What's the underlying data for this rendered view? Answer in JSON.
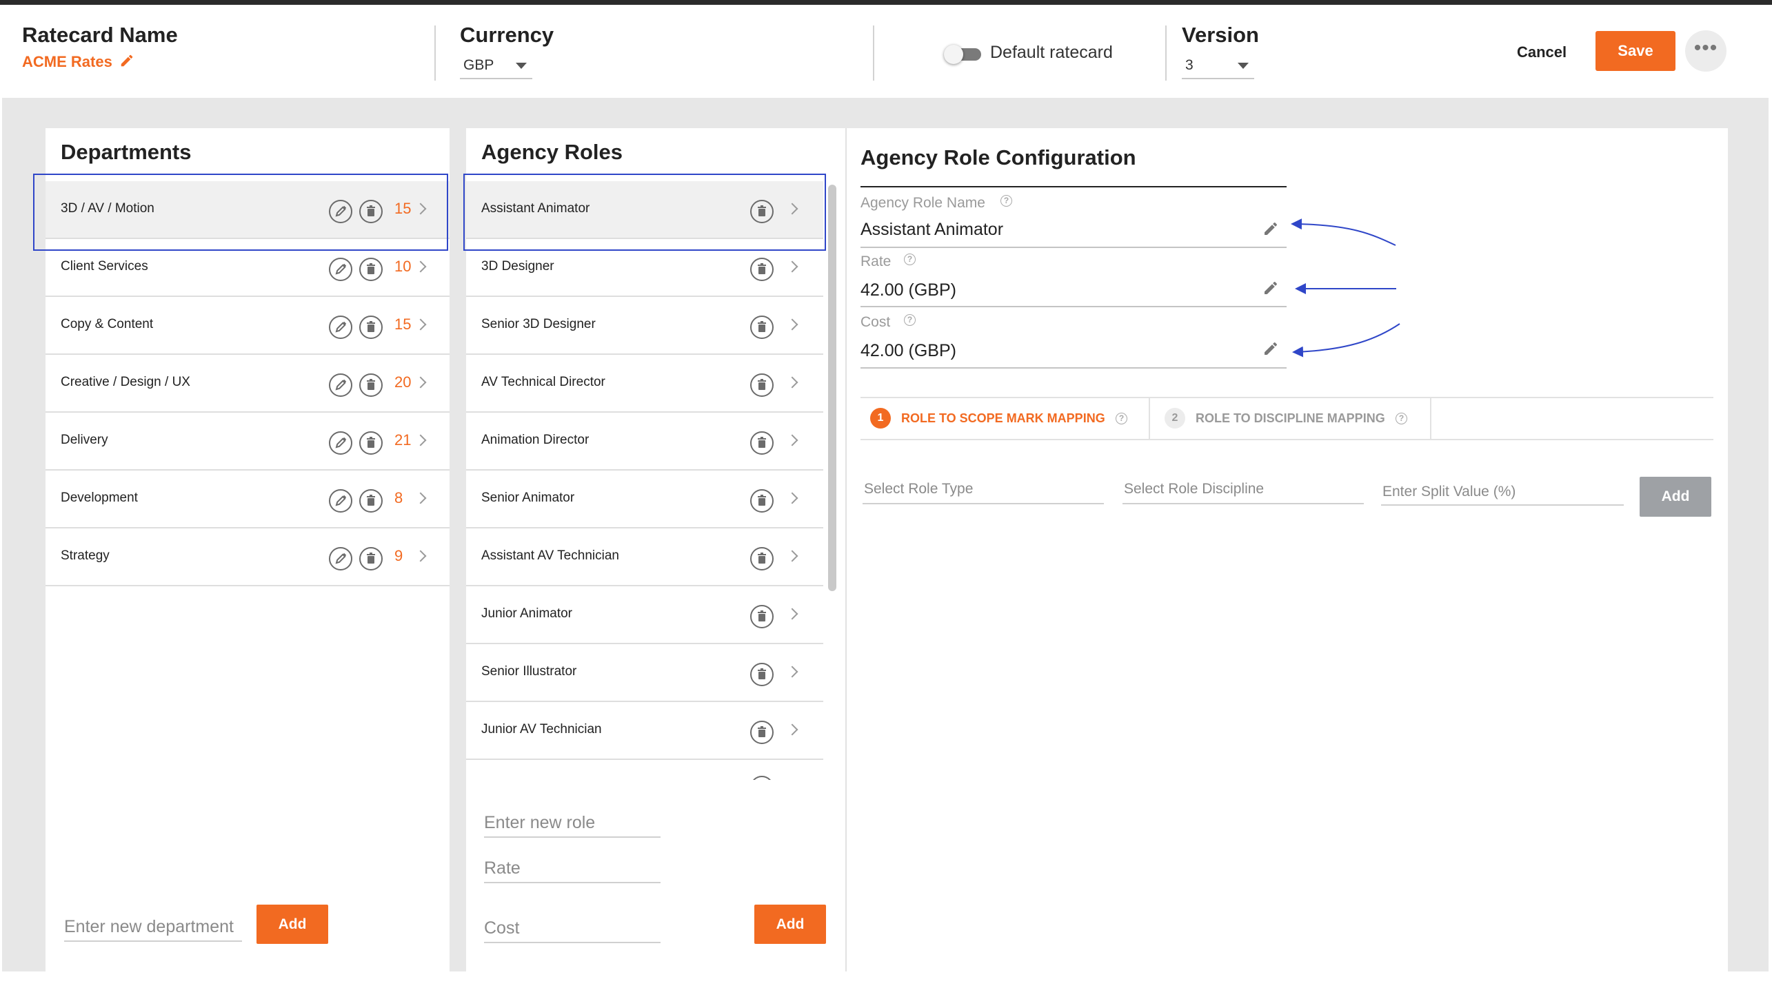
{
  "header": {
    "ratecard_title": "Ratecard Name",
    "ratecard_name": "ACME Rates",
    "currency_title": "Currency",
    "currency_value": "GBP",
    "default_label": "Default ratecard",
    "version_title": "Version",
    "version_value": "3",
    "cancel_label": "Cancel",
    "save_label": "Save",
    "more_label": "•••"
  },
  "departments": {
    "title": "Departments",
    "items": [
      {
        "label": "3D / AV / Motion",
        "count": "15"
      },
      {
        "label": "Client Services",
        "count": "10"
      },
      {
        "label": "Copy & Content",
        "count": "15"
      },
      {
        "label": "Creative / Design / UX",
        "count": "20"
      },
      {
        "label": "Delivery",
        "count": "21"
      },
      {
        "label": "Development",
        "count": "8"
      },
      {
        "label": "Strategy",
        "count": "9"
      }
    ],
    "new_placeholder": "Enter new department",
    "add_label": "Add"
  },
  "roles": {
    "title": "Agency Roles",
    "items": [
      {
        "label": "Assistant Animator"
      },
      {
        "label": "3D Designer"
      },
      {
        "label": "Senior 3D Designer"
      },
      {
        "label": "AV Technical Director"
      },
      {
        "label": "Animation Director"
      },
      {
        "label": "Senior Animator"
      },
      {
        "label": "Assistant AV Technician"
      },
      {
        "label": "Junior Animator"
      },
      {
        "label": "Senior Illustrator"
      },
      {
        "label": "Junior AV Technician"
      }
    ],
    "role_placeholder": "Enter new role",
    "rate_placeholder": "Rate",
    "cost_placeholder": "Cost",
    "add_label": "Add"
  },
  "config": {
    "title": "Agency Role Configuration",
    "name_label": "Agency Role Name",
    "name_value": "Assistant Animator",
    "rate_label": "Rate",
    "rate_value": "42.00 (GBP)",
    "cost_label": "Cost",
    "cost_value": "42.00 (GBP)",
    "tab1_num": "1",
    "tab1_label": "ROLE TO SCOPE MARK MAPPING",
    "tab2_num": "2",
    "tab2_label": "ROLE TO DISCIPLINE MAPPING",
    "role_type_placeholder": "Select Role Type",
    "discipline_placeholder": "Select Role Discipline",
    "split_placeholder": "Enter Split Value (%)",
    "add_label": "Add",
    "help_glyph": "?"
  },
  "colors": {
    "accent": "#f26a21",
    "annotation": "#2f46c8"
  }
}
